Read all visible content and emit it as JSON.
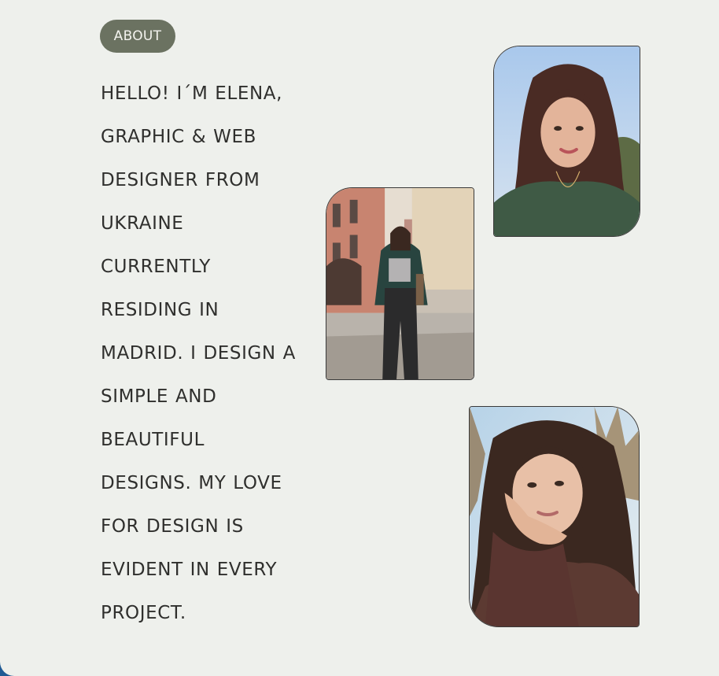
{
  "section": {
    "pill_label": "ABOUT"
  },
  "bio": {
    "lines": [
      "HELLO! I´M ELENA,",
      "GRAPHIC & WEB",
      "DESIGNER FROM",
      "UKRAINE",
      "CURRENTLY",
      "RESIDING IN",
      "MADRID. I DESIGN A",
      "SIMPLE AND",
      "BEAUTIFUL",
      "DESIGNS. MY LOVE",
      "FOR DESIGN IS",
      "EVIDENT IN EVERY",
      "PROJECT."
    ]
  },
  "colors": {
    "background": "#eef0ec",
    "pill": "#6b7261",
    "text": "#2f2f2d",
    "frame_edge": "#1f5a94"
  }
}
